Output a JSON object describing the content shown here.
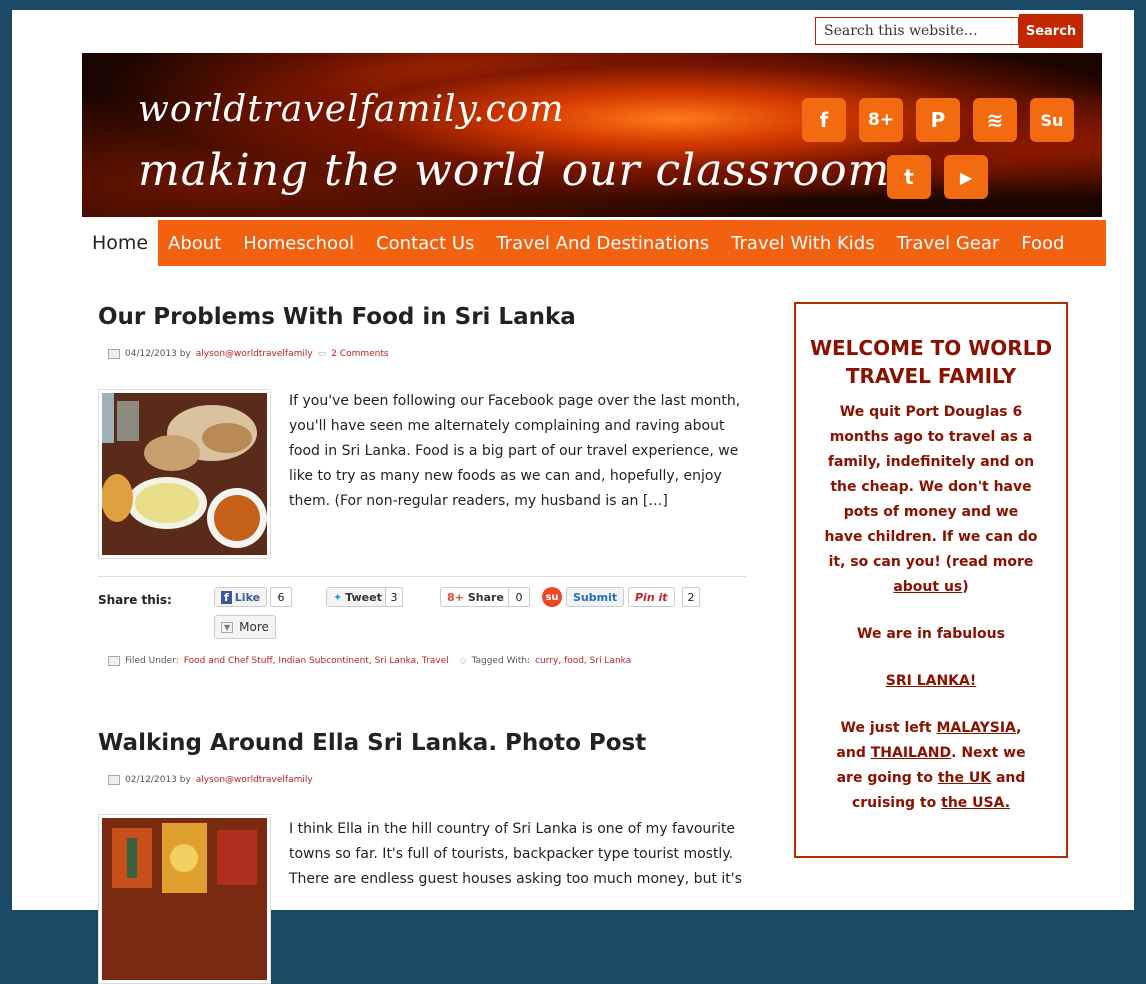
{
  "search": {
    "placeholder": "Search this website…",
    "button": "Search"
  },
  "header": {
    "line1": "worldtravelfamily.com",
    "line2": "making the world our classroom",
    "social": [
      {
        "icon": "facebook-icon",
        "glyph": "f"
      },
      {
        "icon": "google-plus-icon",
        "glyph": "8+"
      },
      {
        "icon": "pinterest-icon",
        "glyph": "P"
      },
      {
        "icon": "rss-icon",
        "glyph": "≋"
      },
      {
        "icon": "stumbleupon-icon",
        "glyph": "Su"
      },
      {
        "icon": "twitter-icon",
        "glyph": "t"
      },
      {
        "icon": "youtube-icon",
        "glyph": "▶"
      }
    ]
  },
  "nav": {
    "home": "Home",
    "items": [
      "About",
      "Homeschool",
      "Contact Us",
      "Travel And Destinations",
      "Travel With Kids",
      "Travel Gear",
      "Food"
    ]
  },
  "posts": [
    {
      "title": "Our Problems With Food in Sri Lanka",
      "date": "04/12/2013 by",
      "author": "alyson@worldtravelfamily",
      "comments": "2 Comments",
      "excerpt": "If you've been following our Facebook page over the last month, you'll have seen me alternately complaining and raving about food in Sri Lanka. Food is a big part of our travel experience, we like to try as many new foods as we can and, hopefully, enjoy them. (For non-regular readers, my husband is an […]",
      "share": {
        "label": "Share this:",
        "like": "Like",
        "like_count": "6",
        "tweet": "Tweet",
        "tweet_count": "3",
        "gshare": "Share",
        "gshare_count": "0",
        "submit": "Submit",
        "pinit": "Pin it",
        "pin_count": "2",
        "more": "More"
      },
      "filed_label": "Filed Under:",
      "filed": "Food and Chef Stuff, Indian Subcontinent, Sri Lanka, Travel",
      "tagged_label": "Tagged With:",
      "tagged": "curry, food, Sri Lanka"
    },
    {
      "title": "Walking Around Ella Sri Lanka. Photo Post",
      "date": "02/12/2013 by",
      "author": "alyson@worldtravelfamily",
      "excerpt": "I think Ella in the hill country of Sri Lanka is one of my favourite towns so far. It's full of tourists, backpacker type tourist mostly. There are endless guest houses asking too much money, but it's"
    }
  ],
  "sidebar": {
    "heading": "WELCOME TO WORLD TRAVEL FAMILY",
    "p1": "We quit Port Douglas 6 months ago to travel as a family, indefinitely and on the cheap. We don't have pots of money and we have children. If we can do it, so can you! (read more",
    "p1_link": "about us",
    "p1_end": ")",
    "p2": "We are in fabulous",
    "p3_link": "SRI LANKA!",
    "p4_a": "We just left",
    "p4_link1": "MALAYSIA",
    "p4_b": ", and",
    "p4_link2": "THAILAND",
    "p4_c": ". Next we are going to",
    "p4_link3": "the UK",
    "p4_d": "and cruising to",
    "p4_link4": "the USA."
  },
  "colors": {
    "accent": "#f26110",
    "dark_red": "#8a1000",
    "page_bg": "#1a4a66"
  }
}
